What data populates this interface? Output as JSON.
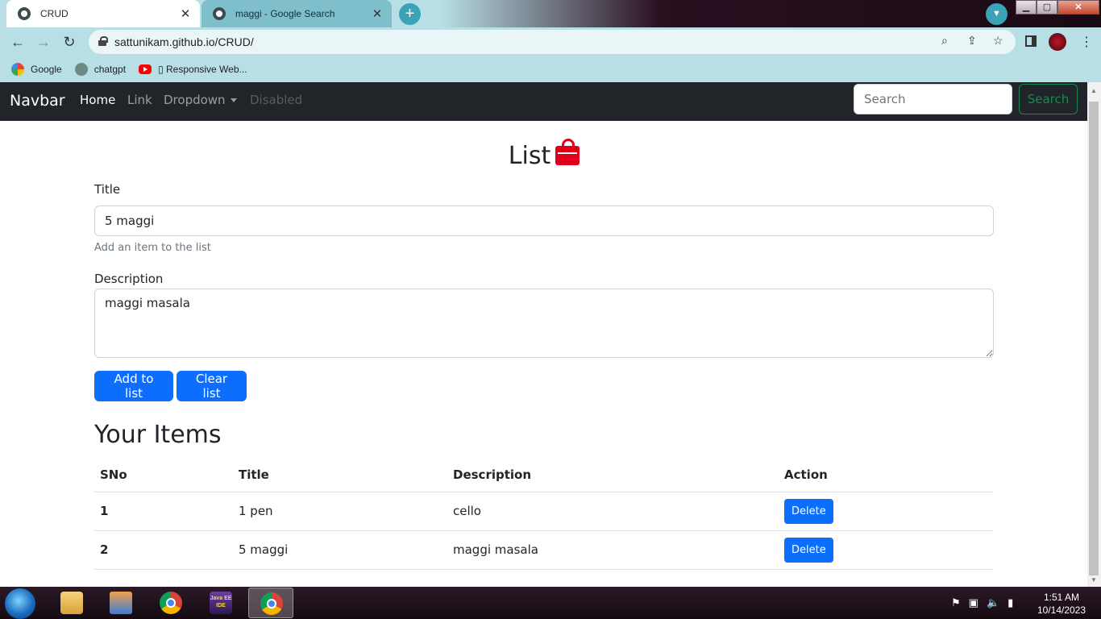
{
  "browser": {
    "tabs": [
      {
        "title": "CRUD",
        "active": true
      },
      {
        "title": "maggi - Google Search",
        "active": false
      }
    ],
    "new_tab": "+",
    "url": "sattunikam.github.io/CRUD/",
    "bookmarks": [
      {
        "label": "Google",
        "icon": "google-icon"
      },
      {
        "label": "chatgpt",
        "icon": "chatgpt-icon"
      },
      {
        "label": "▯ Responsive Web...",
        "icon": "youtube-icon"
      }
    ],
    "window_controls": {
      "minimize": "▁",
      "maximize": "▢",
      "close": "✕"
    }
  },
  "navbar": {
    "brand": "Navbar",
    "links": [
      {
        "label": "Home",
        "state": "active"
      },
      {
        "label": "Link",
        "state": "normal"
      },
      {
        "label": "Dropdown",
        "state": "dropdown"
      },
      {
        "label": "Disabled",
        "state": "disabled"
      }
    ],
    "search_placeholder": "Search",
    "search_button": "Search"
  },
  "form": {
    "heading": "List",
    "title_label": "Title",
    "title_value": "5 maggi",
    "title_help": "Add an item to the list",
    "description_label": "Description",
    "description_value": "maggi masala",
    "add_button": "Add to list",
    "clear_button": "Clear list"
  },
  "items": {
    "heading": "Your Items",
    "columns": [
      "SNo",
      "Title",
      "Description",
      "Action"
    ],
    "rows": [
      {
        "sno": "1",
        "title": "1 pen",
        "description": "cello",
        "action": "Delete"
      },
      {
        "sno": "2",
        "title": "5 maggi",
        "description": "maggi masala",
        "action": "Delete"
      }
    ]
  },
  "taskbar": {
    "time": "1:51 AM",
    "date": "10/14/2023",
    "apps": [
      "explorer-icon",
      "media-player-icon",
      "chrome-icon",
      "java-ee-ide-icon",
      "chrome-icon"
    ],
    "java_label": "Java EE IDE"
  },
  "colors": {
    "navbar_bg": "#212529",
    "primary": "#0d6efd",
    "success": "#198754",
    "bag": "#e0001b",
    "browser_chrome": "#b8dfe6"
  }
}
